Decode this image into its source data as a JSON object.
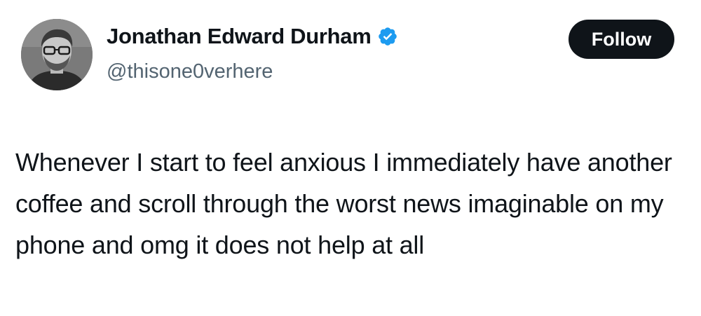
{
  "tweet": {
    "author": {
      "display_name": "Jonathan Edward Durham",
      "handle": "@thisone0verhere",
      "verified": true,
      "verified_icon": "verified-badge-icon",
      "verified_color": "#1d9bf0"
    },
    "follow_label": "Follow",
    "text": "Whenever I start to feel anxious I immediately have another coffee and scroll through the worst news imaginable on my phone and omg it does not help at all"
  }
}
